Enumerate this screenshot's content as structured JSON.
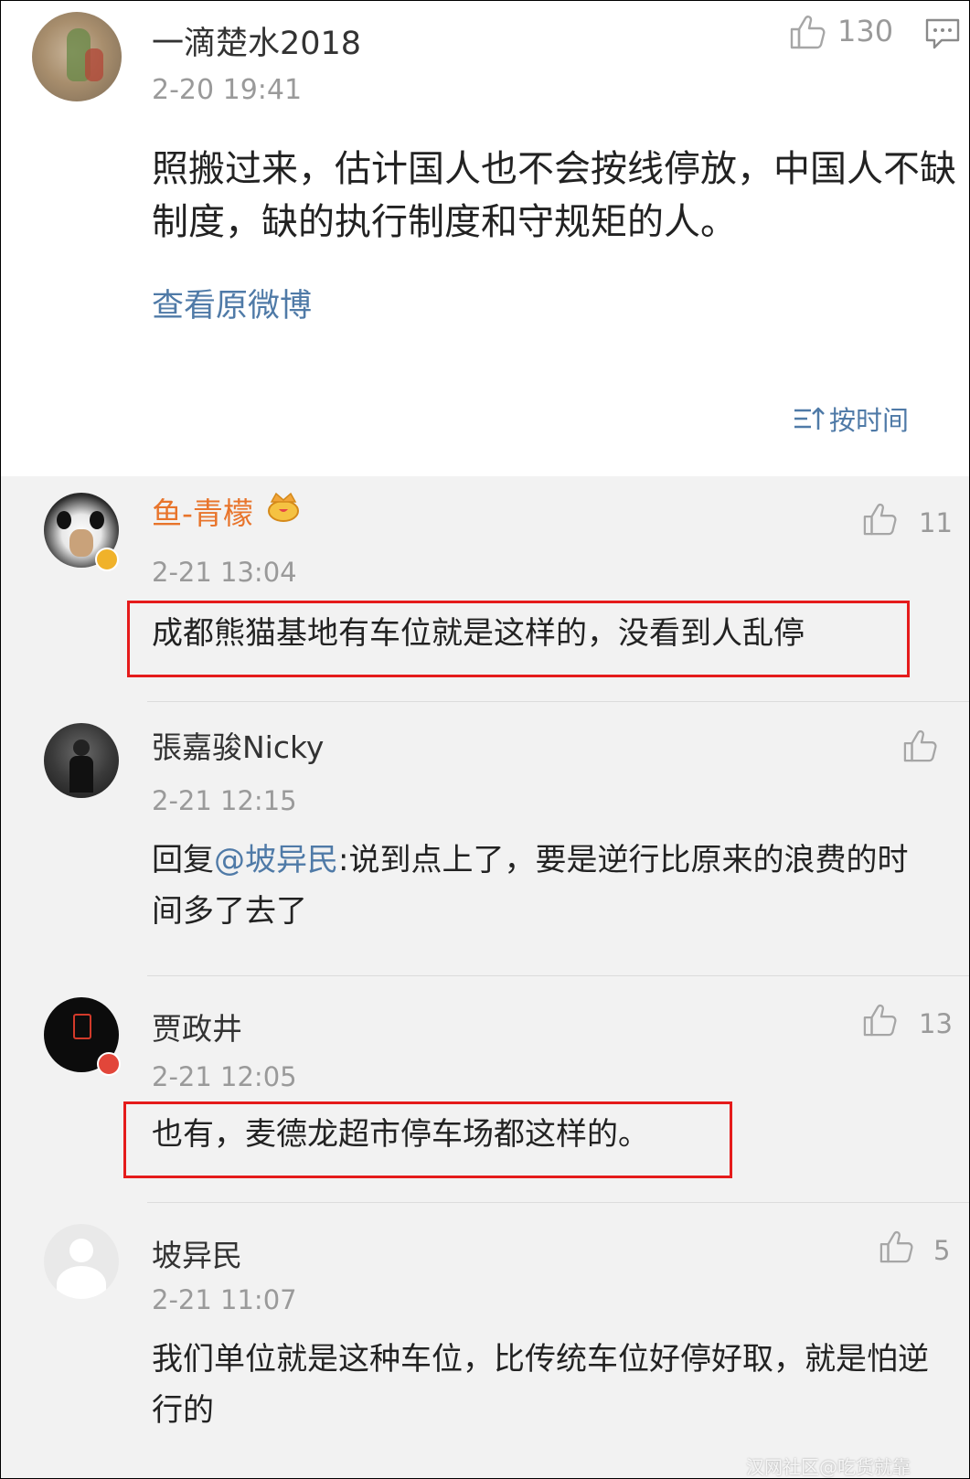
{
  "post": {
    "username": "一滴楚水2018",
    "time": "2-20 19:41",
    "likes": "130",
    "text": "照搬过来，估计国人也不会按线停放，中国人不缺制度，缺的执行制度和守规矩的人。",
    "view_original": "查看原微博",
    "sort_label": "按时间"
  },
  "comments": [
    {
      "username": "鱼-青檬",
      "time": "2-21 13:04",
      "likes": "11",
      "text": "成都熊猫基地有车位就是这样的，没看到人乱停",
      "highlighted": true
    },
    {
      "username": "張嘉骏Nicky",
      "time": "2-21 12:15",
      "likes": "",
      "reply_prefix": "回复",
      "mention": "@坡异民",
      "text": ":说到点上了，要是逆行比原来的浪费的时间多了去了"
    },
    {
      "username": "贾政井",
      "time": "2-21 12:05",
      "likes": "13",
      "text": "也有，麦德龙超市停车场都这样的。",
      "highlighted": true
    },
    {
      "username": "坡异民",
      "time": "2-21 11:07",
      "likes": "5",
      "text": "我们单位就是这种车位，比传统车位好停好取，就是怕逆行的"
    }
  ],
  "watermark": "汉网社区@吃货就靠",
  "colors": {
    "link": "#4f7aa7",
    "vip_name": "#e8742b",
    "highlight_box": "#e51b1b",
    "comment_bg": "#f2f2f2"
  },
  "icons": [
    "thumbs-up-icon",
    "comment-icon",
    "sort-icon",
    "verified-badge-icon",
    "crown-icon"
  ]
}
